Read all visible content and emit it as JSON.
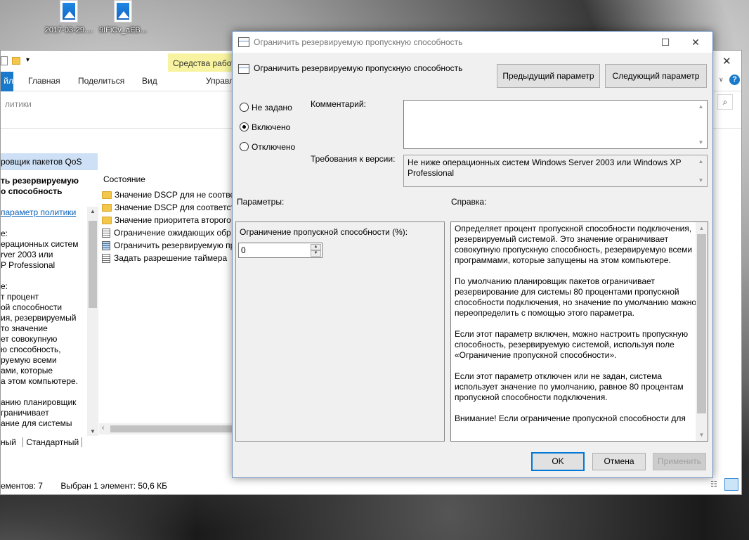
{
  "desktop": {
    "icons": [
      {
        "label": "2017-03-29...."
      },
      {
        "label": "9IFiCv_aEB..."
      }
    ]
  },
  "explorer": {
    "context_tab": "Средства работы",
    "tabs": {
      "file": "йл",
      "home": "Главная",
      "share": "Поделиться",
      "view": "Вид",
      "manage": "Управл"
    },
    "address": "литики",
    "left_header": "ровщик пакетов QoS",
    "left_title": "ть резервируемую\nо способность",
    "left_link": "параметр политики",
    "left_desc_1": "е:",
    "left_desc_2": "ерационных систем\nrver 2003 или\nP Professional",
    "left_desc_3": "е:",
    "left_desc_4": "т процент\nой способности\nия, резервируемый\nто значение\nет совокупную\nю способность,\nруемую всеми\nами, которые\nа этом компьютере.",
    "left_desc_5": "анию планировщик\nграничивает\nание для системы",
    "column_header": "Состояние",
    "items": [
      {
        "label": "Значение DSCP для не соответ"
      },
      {
        "label": "Значение DSCP для соответств"
      },
      {
        "label": "Значение приоритета второго"
      },
      {
        "label": "Ограничение ожидающих обр"
      },
      {
        "label": "Ограничить резервируемую пр"
      },
      {
        "label": "Задать разрешение таймера"
      }
    ],
    "bottom_tabs": {
      "extended": "ный",
      "standard": "Стандартный"
    },
    "status": {
      "count": "ементов: 7",
      "selected": "Выбран 1 элемент: 50,6 КБ"
    }
  },
  "dialog": {
    "title": "Ограничить резервируемую пропускную способность",
    "subtitle": "Ограничить резервируемую пропускную способность",
    "prev_button": "Предыдущий параметр",
    "next_button": "Следующий параметр",
    "radios": {
      "not_configured": "Не задано",
      "enabled": "Включено",
      "disabled": "Отключено"
    },
    "selected_radio": "enabled",
    "comment_label": "Комментарий:",
    "comment_value": "",
    "supported_label": "Требования к версии:",
    "supported_value": "Не ниже операционных систем Windows Server 2003 или Windows XP Professional",
    "options_label": "Параметры:",
    "help_label": "Справка:",
    "limit_label": "Ограничение пропускной способности (%):",
    "limit_value": "0",
    "help_text": "Определяет процент пропускной способности подключения, резервируемый системой. Это значение ограничивает совокупную пропускную способность, резервируемую всеми программами, которые запущены на этом компьютере.\n\nПо умолчанию планировщик пакетов ограничивает резервирование для системы 80 процентами пропускной способности подключения, но значение по умолчанию можно переопределить с помощью этого параметра.\n\nЕсли этот параметр включен, можно настроить пропускную способность, резервируемую системой, используя поле «Ограничение пропускной способности».\n\nЕсли этот параметр отключен или не задан, система использует значение по умолчанию, равное 80 процентам пропускной способности подключения.\n\nВнимание! Если ограничение пропускной способности для",
    "ok": "OK",
    "cancel": "Отмена",
    "apply": "Применить"
  },
  "colors": {
    "accent": "#0078d7",
    "context_tab": "#f7f3a0",
    "active_tab": "#1979ca",
    "pane_header": "#cde0f5"
  }
}
